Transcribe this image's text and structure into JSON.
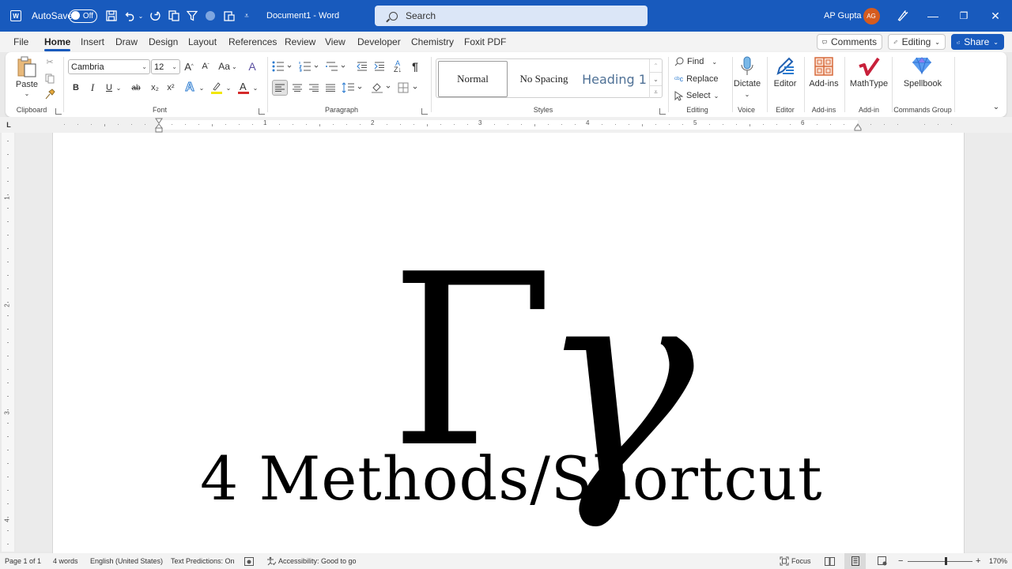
{
  "titlebar": {
    "app_icon": "word-logo-icon",
    "autosave_label": "AutoSave",
    "autosave_state": "Off",
    "document_title": "Document1  -  Word",
    "search_placeholder": "Search",
    "user_name": "AP Gupta",
    "user_initials": "AG",
    "quick_access": [
      "save-icon",
      "undo-icon",
      "redo-icon",
      "copy-icon",
      "filter-icon",
      "record-icon",
      "clipboard-icon",
      "customize-icon"
    ],
    "window_controls": {
      "minimize": "—",
      "restore": "❐",
      "close": "✕"
    }
  },
  "tabs": [
    {
      "label": "File"
    },
    {
      "label": "Home",
      "active": true
    },
    {
      "label": "Insert"
    },
    {
      "label": "Draw"
    },
    {
      "label": "Design"
    },
    {
      "label": "Layout"
    },
    {
      "label": "References"
    },
    {
      "label": "Review"
    },
    {
      "label": "View"
    },
    {
      "label": "Developer"
    },
    {
      "label": "Chemistry"
    },
    {
      "label": "Foxit PDF"
    }
  ],
  "header_buttons": {
    "comments": "Comments",
    "editing": "Editing",
    "share": "Share"
  },
  "ribbon": {
    "clipboard": {
      "paste": "Paste",
      "group": "Clipboard"
    },
    "font": {
      "name": "Cambria",
      "size": "12",
      "group": "Font",
      "change_case": "Aa",
      "bold": "B",
      "italic": "I",
      "underline": "U",
      "strike": "ab",
      "subscript": "x₂",
      "superscript": "x²",
      "highlight_color": "#f2e600",
      "font_color": "#d42a2a"
    },
    "paragraph": {
      "group": "Paragraph",
      "sort": "A↓Z",
      "pilcrow": "¶"
    },
    "styles": {
      "group": "Styles",
      "items": [
        "Normal",
        "No Spacing",
        "Heading 1"
      ]
    },
    "editing": {
      "group": "Editing",
      "find": "Find",
      "replace": "Replace",
      "select": "Select"
    },
    "voice": {
      "group": "Voice",
      "dictate": "Dictate"
    },
    "editor": {
      "group": "Editor",
      "label": "Editor"
    },
    "addins": {
      "group": "Add-ins",
      "label": "Add-ins"
    },
    "mathtype": {
      "group": "Add-in",
      "label": "MathType"
    },
    "spellbook": {
      "group": "Commands Group",
      "label": "Spellbook"
    }
  },
  "ruler": {
    "h_numbers": [
      "1",
      "2",
      "3",
      "4",
      "5",
      "6"
    ],
    "v_numbers": [
      "1",
      "2",
      "3",
      "4"
    ]
  },
  "document": {
    "upper_gamma": "Γ",
    "lower_gamma": "γ",
    "heading": "4 Methods/Shortcut"
  },
  "statusbar": {
    "page": "Page 1 of 1",
    "words": "4 words",
    "language": "English (United States)",
    "text_predictions": "Text Predictions: On",
    "accessibility": "Accessibility: Good to go",
    "focus": "Focus",
    "zoom_out": "−",
    "zoom_in": "+",
    "zoom_level": "170%"
  }
}
